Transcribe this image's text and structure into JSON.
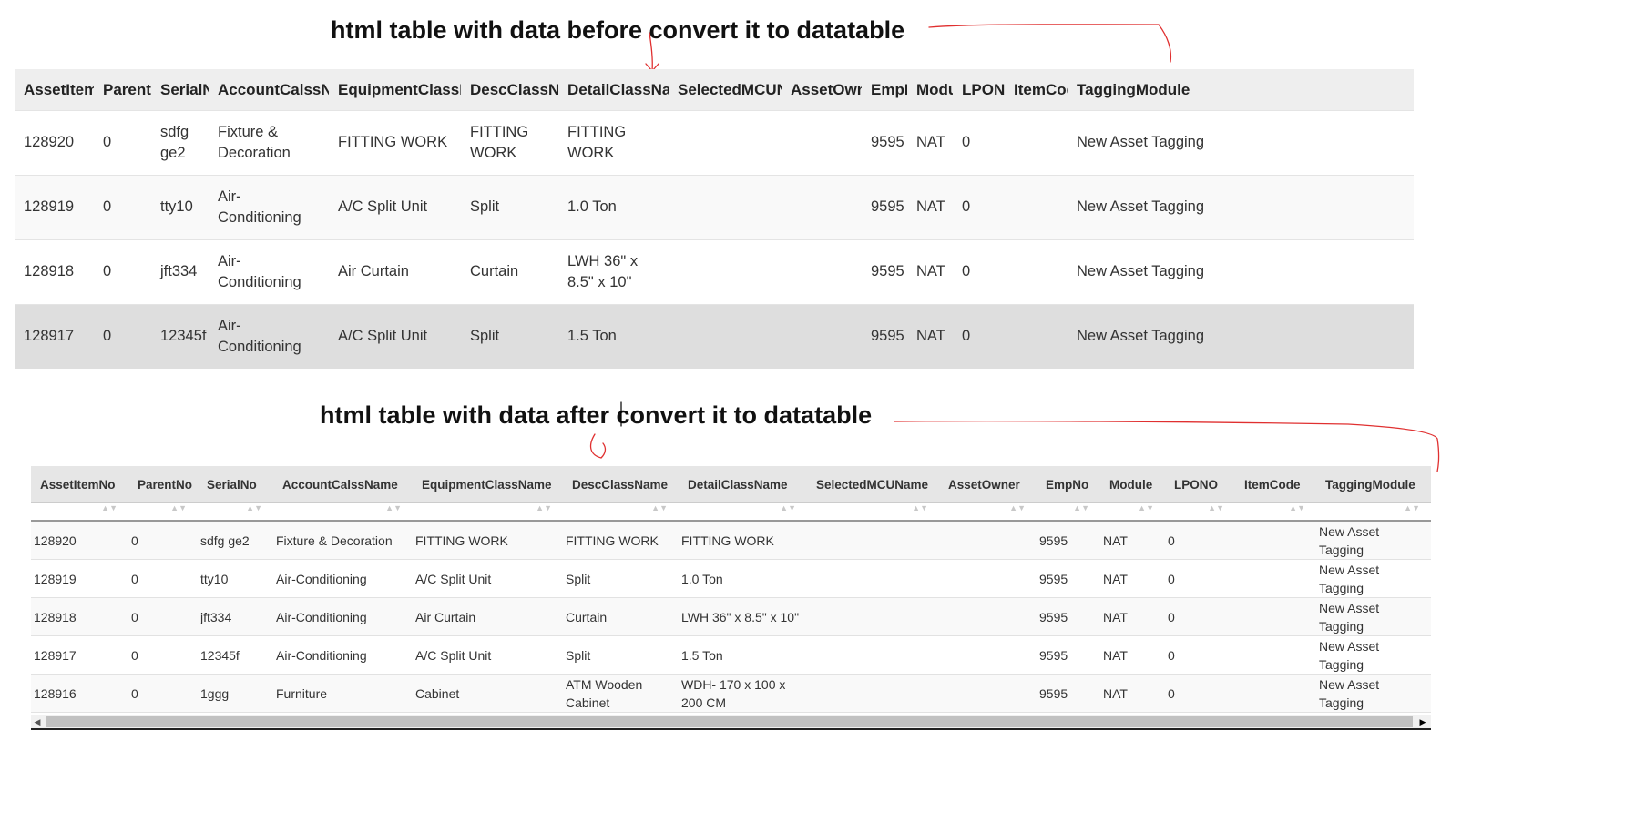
{
  "headings": {
    "before": "html table with data before convert it to datatable",
    "after": "html table with data after convert it to datatable"
  },
  "table1": {
    "headers": [
      "AssetItem",
      "ParentI",
      "SerialN",
      "AccountCalssN",
      "EquipmentClassN",
      "DescClassNa",
      "DetailClassNa",
      "SelectedMCUN",
      "AssetOwn",
      "EmpN",
      "Modu",
      "LPONO",
      "ItemCod",
      "TaggingModule"
    ],
    "rows": [
      [
        "128920",
        "0",
        "sdfg ge2",
        "Fixture & Decoration",
        "FITTING WORK",
        "FITTING WORK",
        "FITTING WORK",
        "",
        "",
        "9595",
        "NAT",
        "0",
        "",
        "New Asset Tagging"
      ],
      [
        "128919",
        "0",
        "tty10",
        "Air-Conditioning",
        "A/C Split Unit",
        "Split",
        "1.0 Ton",
        "",
        "",
        "9595",
        "NAT",
        "0",
        "",
        "New Asset Tagging"
      ],
      [
        "128918",
        "0",
        "jft334",
        "Air-Conditioning",
        "Air Curtain",
        "Curtain",
        "LWH 36\" x 8.5\" x 10\"",
        "",
        "",
        "9595",
        "NAT",
        "0",
        "",
        "New Asset Tagging"
      ],
      [
        "128917",
        "0",
        "12345f",
        "Air-Conditioning",
        "A/C Split Unit",
        "Split",
        "1.5 Ton",
        "",
        "",
        "9595",
        "NAT",
        "0",
        "",
        "New Asset Tagging"
      ]
    ]
  },
  "table2": {
    "headers": [
      "AssetItemNo",
      "ParentNo",
      "SerialNo",
      "AccountCalssName",
      "EquipmentClassName",
      "DescClassName",
      "DetailClassName",
      "SelectedMCUName",
      "AssetOwner",
      "EmpNo",
      "Module",
      "LPONO",
      "ItemCode",
      "TaggingModule"
    ],
    "rows": [
      [
        "128920",
        "0",
        "sdfg ge2",
        "Fixture & Decoration",
        "FITTING WORK",
        "FITTING WORK",
        "FITTING WORK",
        "",
        "",
        "9595",
        "NAT",
        "0",
        "",
        "New Asset Tagging"
      ],
      [
        "128919",
        "0",
        "tty10",
        "Air-Conditioning",
        "A/C Split Unit",
        "Split",
        "1.0 Ton",
        "",
        "",
        "9595",
        "NAT",
        "0",
        "",
        "New Asset Tagging"
      ],
      [
        "128918",
        "0",
        "jft334",
        "Air-Conditioning",
        "Air Curtain",
        "Curtain",
        "LWH 36\" x 8.5\" x 10\"",
        "",
        "",
        "9595",
        "NAT",
        "0",
        "",
        "New Asset Tagging"
      ],
      [
        "128917",
        "0",
        "12345f",
        "Air-Conditioning",
        "A/C Split Unit",
        "Split",
        "1.5 Ton",
        "",
        "",
        "9595",
        "NAT",
        "0",
        "",
        "New Asset Tagging"
      ],
      [
        "128916",
        "0",
        "1ggg",
        "Furniture",
        "Cabinet",
        "ATM Wooden Cabinet",
        "WDH- 170 x 100 x 200 CM",
        "",
        "",
        "9595",
        "NAT",
        "0",
        "",
        "New Asset Tagging"
      ]
    ]
  },
  "scrollbar": {
    "left_arrow": "◀",
    "right_arrow": "▶"
  },
  "sort_icon": "▲▼",
  "annotation_color": "#e03030"
}
